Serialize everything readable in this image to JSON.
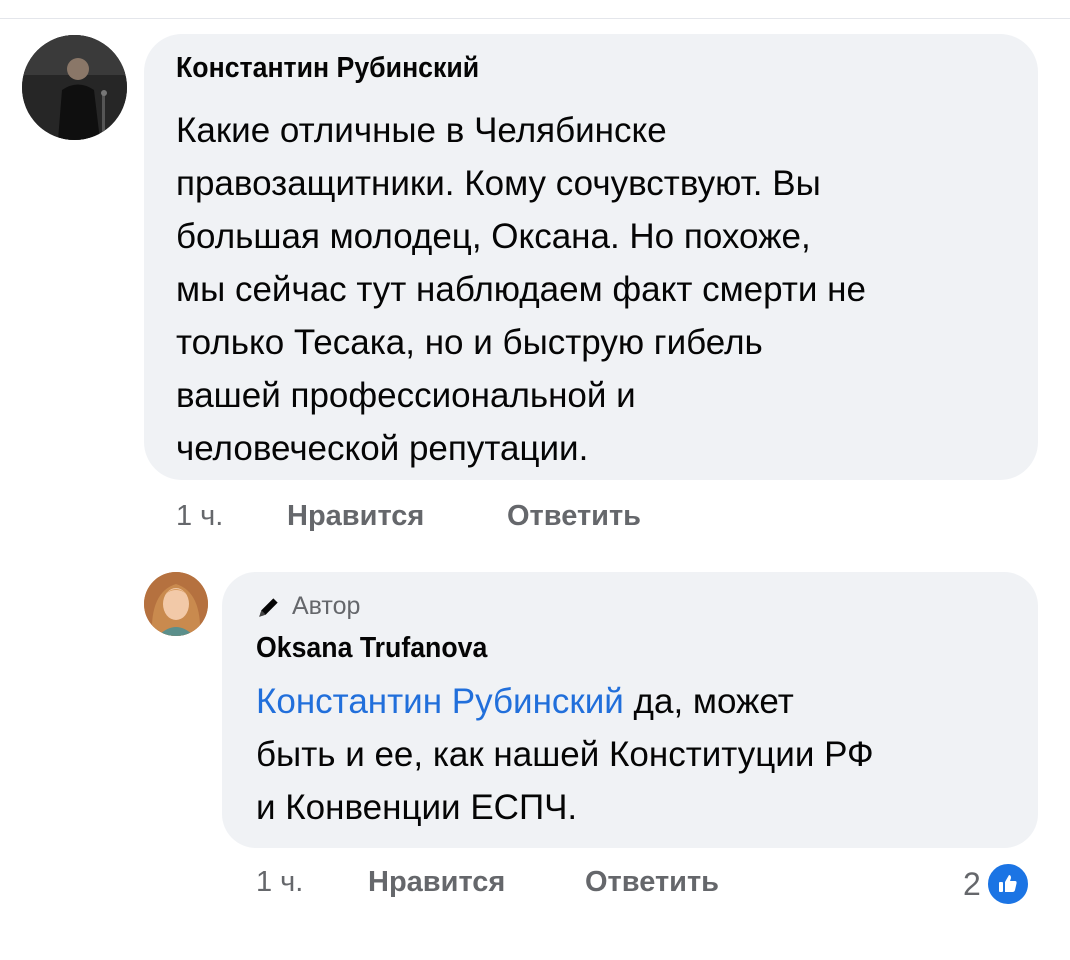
{
  "comment": {
    "author": "Константин Рубинский",
    "text_lines": [
      "Какие отличные в Челябинске",
      "правозащитники. Кому сочувствуют. Вы",
      "большая молодец, Оксана. Но похоже,",
      "мы сейчас тут наблюдаем факт смерти не",
      "только Тесака, но и быструю гибель",
      "вашей профессиональной и",
      "человеческой репутации."
    ],
    "time": "1 ч.",
    "like_label": "Нравится",
    "reply_label": "Ответить"
  },
  "reply": {
    "badge": "Автор",
    "author": "Oksana Trufanova",
    "mention": "Константин Рубинский",
    "line1_rest": " да, может",
    "line2": "быть и ее, как нашей Конституции РФ",
    "line3": "и Конвенции ЕСПЧ.",
    "time": "1 ч.",
    "like_label": "Нравится",
    "reply_label": "Ответить",
    "reaction_count": "2"
  },
  "icons": {
    "pencil": "pencil-icon",
    "like": "like-thumb-icon"
  },
  "colors": {
    "bubble": "#f0f2f5",
    "mention": "#216fdb",
    "meta": "#65676b",
    "like": "#1b74e4"
  }
}
